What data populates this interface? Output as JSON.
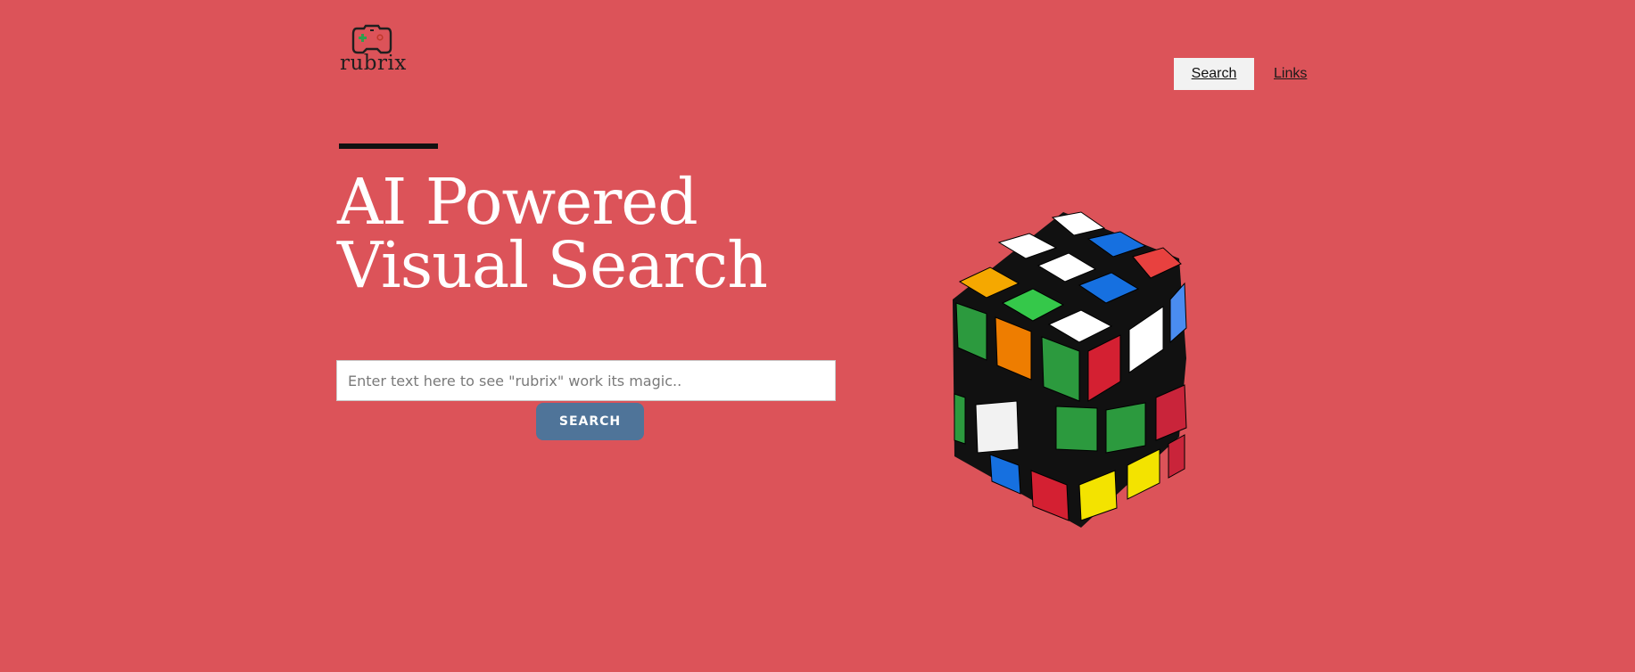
{
  "brand": {
    "name": "rubrix"
  },
  "nav": {
    "search_label": "Search",
    "links_label": "Links"
  },
  "hero": {
    "title_line1": "AI Powered",
    "title_line2": "Visual Search"
  },
  "search": {
    "placeholder": "Enter text here to see \"rubrix\" work its magic..",
    "value": "",
    "button_label": "SEARCH"
  },
  "colors": {
    "background": "#dc5359",
    "button": "#4f7499",
    "nav_active_bg": "#f2f2f2",
    "accent_bar": "#111111"
  },
  "icons": {
    "logo": "gamepad-icon",
    "hero_image": "rubiks-cube-image"
  }
}
